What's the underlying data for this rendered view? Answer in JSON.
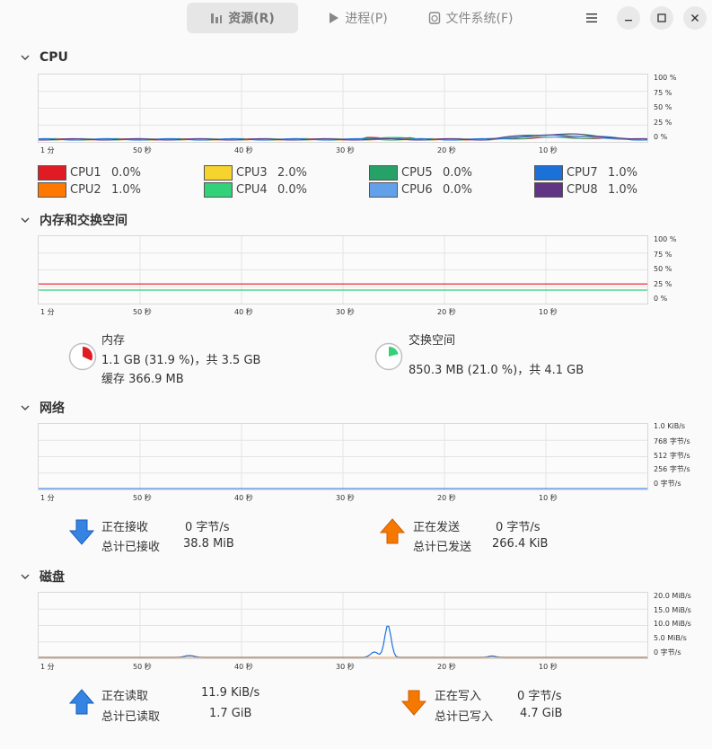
{
  "tabs": [
    {
      "label": "资源(R)",
      "icon": "bar-chart-icon"
    },
    {
      "label": "进程(P)",
      "icon": "play-icon"
    },
    {
      "label": "文件系统(F)",
      "icon": "disk-icon"
    }
  ],
  "time_labels": [
    "1 分",
    "50 秒",
    "40 秒",
    "30 秒",
    "20 秒",
    "10 秒"
  ],
  "cpu": {
    "title": "CPU",
    "ticks": [
      "100 %",
      "75 %",
      "50 %",
      "25 %",
      "0 %"
    ],
    "legend": [
      {
        "name": "CPU1",
        "value": "0.0%",
        "color": "#e01b24"
      },
      {
        "name": "CPU2",
        "value": "1.0%",
        "color": "#ff7800"
      },
      {
        "name": "CPU3",
        "value": "2.0%",
        "color": "#f6d32d"
      },
      {
        "name": "CPU4",
        "value": "0.0%",
        "color": "#33d17a"
      },
      {
        "name": "CPU5",
        "value": "0.0%",
        "color": "#26a269"
      },
      {
        "name": "CPU6",
        "value": "0.0%",
        "color": "#62a0ea"
      },
      {
        "name": "CPU7",
        "value": "1.0%",
        "color": "#1c71d8"
      },
      {
        "name": "CPU8",
        "value": "1.0%",
        "color": "#613583"
      }
    ]
  },
  "memory": {
    "title": "内存和交换空间",
    "ticks": [
      "100 %",
      "75 %",
      "50 %",
      "25 %",
      "0 %"
    ],
    "mem_label": "内存",
    "mem_line1": "1.1 GB (31.9 %)，共 3.5 GB",
    "mem_line2": "缓存 366.9 MB",
    "mem_color": "#e01b24",
    "mem_fraction": 0.319,
    "swap_label": "交换空间",
    "swap_line1": "850.3 MB (21.0 %)，共 4.1 GB",
    "swap_color": "#33d17a",
    "swap_fraction": 0.21
  },
  "network": {
    "title": "网络",
    "ticks": [
      "1.0 KiB/s",
      "768 字节/s",
      "512 字节/s",
      "256 字节/s",
      "0 字节/s"
    ],
    "recv_label": "正在接收",
    "recv_value": "0 字节/s",
    "recv_total_label": "总计已接收",
    "recv_total_value": "38.8 MiB",
    "send_label": "正在发送",
    "send_value": "0 字节/s",
    "send_total_label": "总计已发送",
    "send_total_value": "266.4 KiB"
  },
  "disk": {
    "title": "磁盘",
    "ticks": [
      "20.0 MiB/s",
      "15.0 MiB/s",
      "10.0 MiB/s",
      "5.0 MiB/s",
      "0 字节/s"
    ],
    "read_label": "正在读取",
    "read_value": "11.9 KiB/s",
    "read_total_label": "总计已读取",
    "read_total_value": "1.7 GiB",
    "write_label": "正在写入",
    "write_value": "0 字节/s",
    "write_total_label": "总计已写入",
    "write_total_value": "4.7 GiB"
  }
}
